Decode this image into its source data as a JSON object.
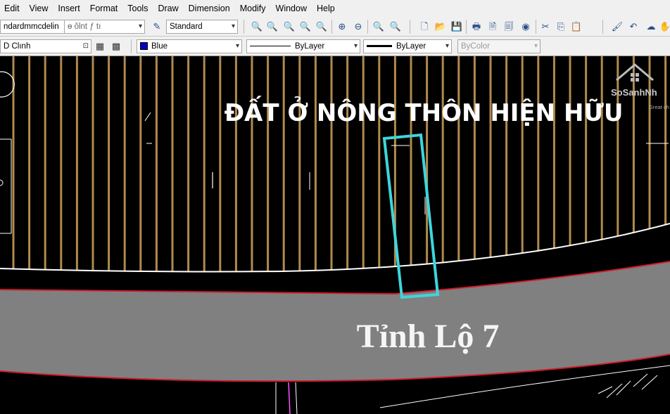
{
  "menu": {
    "items": [
      "Edit",
      "View",
      "Insert",
      "Format",
      "Tools",
      "Draw",
      "Dimension",
      "Modify",
      "Window",
      "Help"
    ]
  },
  "toolbar1": {
    "text_style_combo": "ndardmmcdelin",
    "text_style_combo2": "ɵ ǒlnt ƒ tı",
    "dim_style_combo": "Standard"
  },
  "toolbar2": {
    "layer_combo": "D Clınh",
    "color_combo": "Blue",
    "linetype_combo": "ByLayer",
    "lineweight_combo": "ByLayer",
    "plotstyle_combo": "ByColor"
  },
  "drawing": {
    "label_top": "ĐẤT Ở NÔNG THÔN HIỆN HỮU",
    "label_road": "Tỉnh Lộ 7"
  },
  "watermark": {
    "logo_text": "SoSanhNh",
    "tagline": "Great ch"
  },
  "colors": {
    "hatch": "#b08a4e",
    "road": "#808080",
    "road_edge": "#d11a2a",
    "parcel": "#3fd5dc",
    "background": "#000000"
  }
}
